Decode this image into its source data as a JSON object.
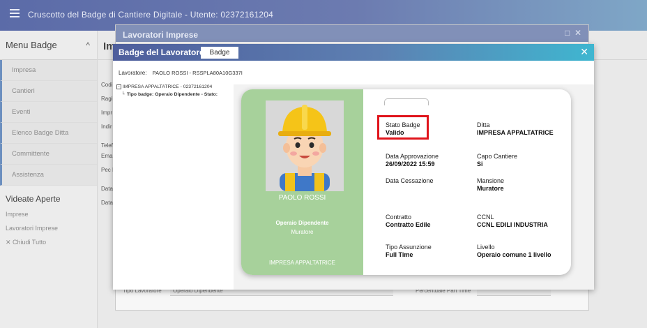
{
  "topbar": {
    "title": "Cruscotto del Badge di Cantiere Digitale - Utente: 02372161204"
  },
  "sidebar": {
    "header": "Menu Badge",
    "items": [
      "Impresa",
      "Cantieri",
      "Eventi",
      "Elenco Badge Ditta",
      "Committente",
      "Assistenza"
    ],
    "section": "Videate Aperte",
    "open_links": [
      "Imprese",
      "Lavoratori Imprese"
    ],
    "close_all": "Chiudi Tutto"
  },
  "main": {
    "title_fragment": "Im",
    "labels": [
      "Codi",
      "Ragi",
      "Impr",
      "Indir",
      "Telef",
      "Ema",
      "Pec I",
      "Data",
      "Data"
    ]
  },
  "lavoratori_window": {
    "title": "Lavoratori Imprese",
    "tipo_lavoratore_label": "Tipo Lavoratore",
    "tipo_lavoratore_value": "Operaio Dipendente",
    "part_time_label": "Percentuale Part Time"
  },
  "badge_dialog": {
    "title": "Badge del Lavoratore",
    "tab": "Badge",
    "worker_label": "Lavoratore:",
    "worker_value": "PAOLO ROSSI - RSSPLA80A10G337I",
    "tree_company": "IMPRESA APPALTATRICE - 02372161204",
    "tree_badge": "Tipo badge: Operaio Dipendente - Stato:"
  },
  "badge_card": {
    "name": "PAOLO ROSSI",
    "role": "Operaio Dipendente",
    "job": "Muratore",
    "company": "IMPRESA APPALTATRICE",
    "fields": [
      {
        "label": "Stato Badge",
        "value": "Valido"
      },
      {
        "label": "Ditta",
        "value": "IMPRESA APPALTATRICE"
      },
      {
        "label": "Data Approvazione",
        "value": "26/09/2022 15:59"
      },
      {
        "label": "Capo Cantiere",
        "value": "Si"
      },
      {
        "label": "Data Cessazione",
        "value": ""
      },
      {
        "label": "Mansione",
        "value": "Muratore"
      },
      {
        "label": "Contratto",
        "value": "Contratto Edile"
      },
      {
        "label": "CCNL",
        "value": "CCNL EDILI INDUSTRIA"
      },
      {
        "label": "Tipo Assunzione",
        "value": "Full Time"
      },
      {
        "label": "Livello",
        "value": "Operaio comune 1 livello"
      }
    ]
  },
  "colors": {
    "highlight": "#e0141b",
    "card_green": "#a7d19b",
    "header_blue": "#5b6ba8"
  },
  "icons": [
    "menu-icon",
    "chevron-up-icon",
    "close-icon",
    "minimize-icon",
    "expand-tree-icon"
  ]
}
